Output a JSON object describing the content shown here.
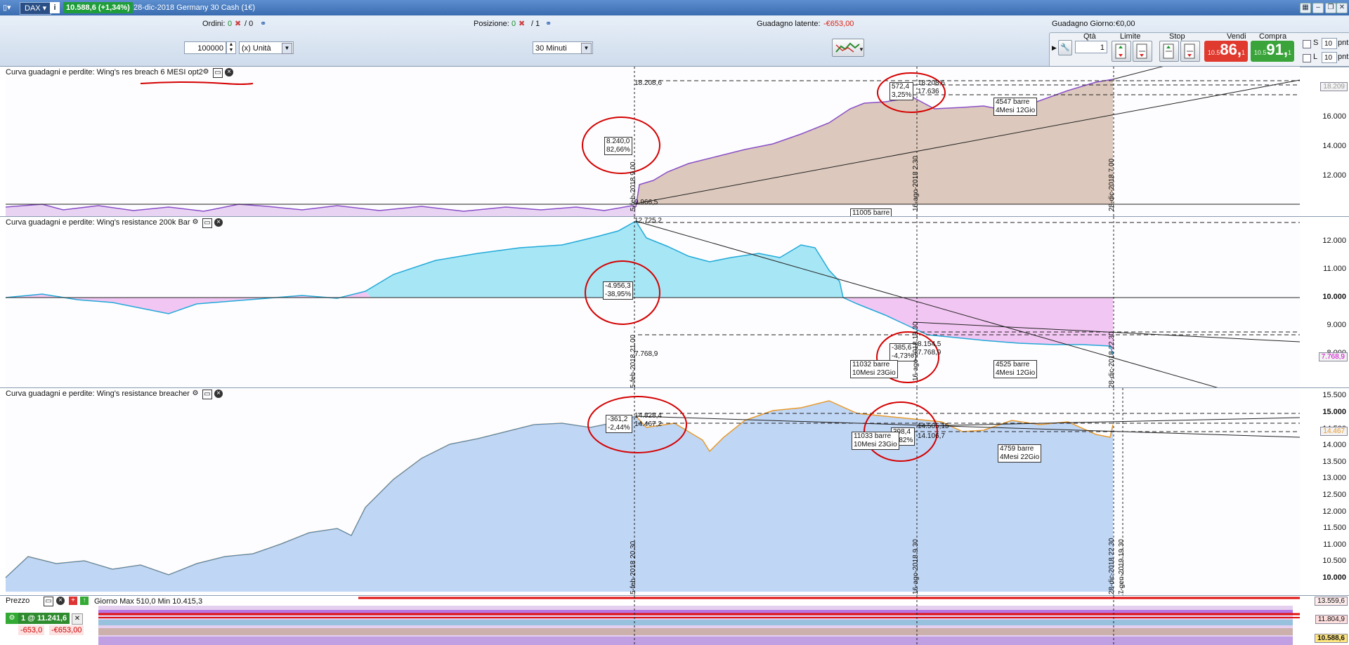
{
  "titlebar": {
    "symbol": "DAX",
    "price_change": "10.588,6 (+1,34%)",
    "title": "28-dic-2018 Germany 30 Cash (1€)"
  },
  "toolbar": {
    "orders_label": "Ordini:",
    "orders_value": "0",
    "orders_total": "/ 0",
    "position_label": "Posizione:",
    "position_value": "0",
    "position_total": "/ 1",
    "unrealized_label": "Guadagno latente:",
    "unrealized_value": "-€653,00",
    "day_gain_label": "Guadagno Giorno:",
    "day_gain_value": "€0,00",
    "quantity_value": "100000",
    "unit_value": "(x) Unità",
    "timeframe_value": "30 Minuti",
    "qty_label": "Qtà",
    "qty_value": "1",
    "limit_label": "Limite",
    "stop_label": "Stop",
    "sell_label": "Vendi",
    "buy_label": "Compra",
    "sell_prefix": "10.5",
    "sell_price": "86,",
    "sell_sup": "1",
    "buy_prefix": "10.5",
    "buy_price": "91,",
    "buy_sup": "1",
    "s_label": "S",
    "l_label": "L",
    "s_value": "10",
    "l_value": "10",
    "pnt_label": "pnt"
  },
  "panel1": {
    "title": "Curva guadagni e perdite: Wing's res breach 6 MESI opt2",
    "ticks": [
      "16.000",
      "14.000",
      "12.000"
    ],
    "price_tag": "18.209",
    "level_top": "18.208,6",
    "level_base": "9.966,5",
    "note1_line1": "8.240,0",
    "note1_line2": "82,66%",
    "note2_line1": "572,4",
    "note2_line2": "3,25%",
    "note2_side1": "18.208,6",
    "note2_side2": "17.636",
    "note3_line1": "4547 barre",
    "note3_line2": "4Mesi 12Gio",
    "note4": "11005 barre",
    "vdate1": "5-feb-2018 9.00",
    "vdate2": "16-ago-2018 2.30",
    "vdate3": "28-dic-2018 7.00"
  },
  "panel2": {
    "title": "Curva guadagni e perdite: Wing's resistance 200k Bar",
    "ticks": [
      "12.000",
      "11.000",
      "10.000",
      "9.000",
      "8.000"
    ],
    "price_tag": "7.768,9",
    "level_top": "12.725,2",
    "level_low": "7.768,9",
    "note1_line1": "-4.956,3",
    "note1_line2": "-38,95%",
    "note2_line1": "-385,6",
    "note2_line2": "-4,73%",
    "note2_side1": "8.154,5",
    "note2_side2": "7.768,9",
    "note3_line1": "11032 barre",
    "note3_line2": "10Mesi 23Gio",
    "note4_line1": "4525 barre",
    "note4_line2": "4Mesi 12Gio",
    "vdate1": "5-feb-2018 21.00",
    "vdate2": "16-ago-2018 13.30",
    "vdate3": "28-dic-2018 22.30"
  },
  "panel3": {
    "title": "Curva guadagni e perdite: Wing's resistance breacher",
    "ticks": [
      "15.500",
      "15.000",
      "14.500",
      "14.000",
      "13.500",
      "13.000",
      "12.500",
      "12.000",
      "11.500",
      "11.000",
      "10.500",
      "10.000"
    ],
    "price_tag": "14.467",
    "note1_line1": "-361,2",
    "note1_line2": "-2,44%",
    "note1_side1": "14.828,4",
    "note1_side2": "14.467,2",
    "note2_line1": "398,4",
    "note2_line2": "2,82%",
    "note2_side1": "14.505,15",
    "note2_side2": "14.106,7",
    "note3_line1": "11033 barre",
    "note3_line2": "10Mesi 23Gio",
    "note4_line1": "4759 barre",
    "note4_line2": "4Mesi 22Gio",
    "vdate1": "5-feb-2018 20.30",
    "vdate2": "16-ago-2018 9.30",
    "vdate3": "28-dic-2018 22.30",
    "vdate4": "7-gen-2019 19.30"
  },
  "price_panel": {
    "title": "Prezzo",
    "info": "Giorno Max 510,0 Min 10.415,3",
    "tag1": "13.559,6",
    "tag2": "11.804,9",
    "tag3": "10.588,6",
    "position_qty": "1 @ 11.241,6",
    "pnl1": "-653,0",
    "pnl2": "-€653,00"
  },
  "colors": {
    "title_bg": "#3a6cb0",
    "sell": "#e03a2f",
    "buy": "#3aa43a",
    "annotation": "#d40000",
    "area_brown": "#d8c8bc",
    "area_cyan": "#a7e6f5",
    "area_pink": "#f2c6f2",
    "area_blue": "#c0d6f5"
  }
}
